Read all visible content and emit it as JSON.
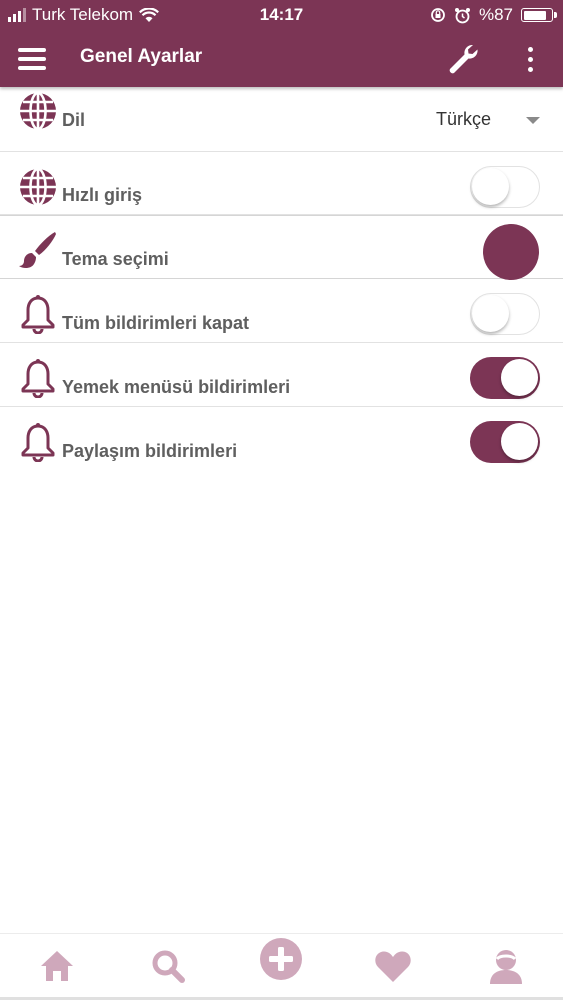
{
  "status_bar": {
    "carrier": "Turk Telekom",
    "time": "14:17",
    "battery": "%87"
  },
  "app_bar": {
    "title": "Genel Ayarlar",
    "icons": [
      "menu-icon",
      "wrench-icon",
      "more-vert-icon"
    ]
  },
  "settings": {
    "language": {
      "label": "Dil",
      "value": "Türkçe",
      "icon": "globe-icon"
    },
    "quick_login": {
      "label": "Hızlı giriş",
      "enabled": false,
      "icon": "globe-icon"
    },
    "theme": {
      "label": "Tema seçimi",
      "color": "#7c3555",
      "icon": "paint-brush-icon"
    },
    "mute_all": {
      "label": "Tüm bildirimleri kapat",
      "enabled": false,
      "icon": "bell-icon"
    },
    "food_menu": {
      "label": "Yemek menüsü bildirimleri",
      "enabled": true,
      "icon": "bell-icon"
    },
    "share": {
      "label": "Paylaşım bildirimleri",
      "enabled": true,
      "icon": "bell-icon"
    }
  },
  "bottom_nav": {
    "items": [
      "home-icon",
      "search-icon",
      "add-circle-icon",
      "heart-icon",
      "profile-icon"
    ],
    "color": "#cfa8bb"
  },
  "colors": {
    "primary": "#7c3555",
    "label_text": "#5f5f5f"
  }
}
